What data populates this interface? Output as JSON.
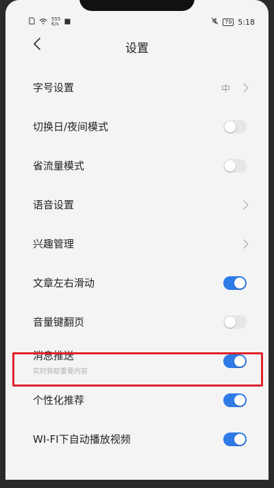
{
  "status_bar": {
    "speed_value": "555",
    "speed_unit": "K/s",
    "battery": "79",
    "time": "5:18"
  },
  "header": {
    "title": "设置"
  },
  "settings": [
    {
      "label": "字号设置",
      "value": "中",
      "control": "chevron"
    },
    {
      "label": "切换日/夜间模式",
      "control": "toggle",
      "on": false
    },
    {
      "label": "省流量模式",
      "control": "toggle",
      "on": false
    },
    {
      "label": "语音设置",
      "control": "chevron"
    },
    {
      "label": "兴趣管理",
      "control": "chevron"
    },
    {
      "label": "文章左右滑动",
      "control": "toggle",
      "on": true
    },
    {
      "label": "音量键翻页",
      "control": "toggle",
      "on": false
    },
    {
      "label": "消息推送",
      "sublabel": "实时获取重要内容",
      "control": "toggle",
      "on": true,
      "highlighted": true
    },
    {
      "label": "个性化推荐",
      "control": "toggle",
      "on": true
    },
    {
      "label": "WI-FI下自动播放视频",
      "control": "toggle",
      "on": true
    }
  ],
  "colors": {
    "accent": "#2f7be6",
    "highlight_border": "#e0202a",
    "background": "#f4f4f5"
  },
  "icons": {
    "back": "chevron-left-icon",
    "row_chevron": "chevron-right-icon"
  }
}
